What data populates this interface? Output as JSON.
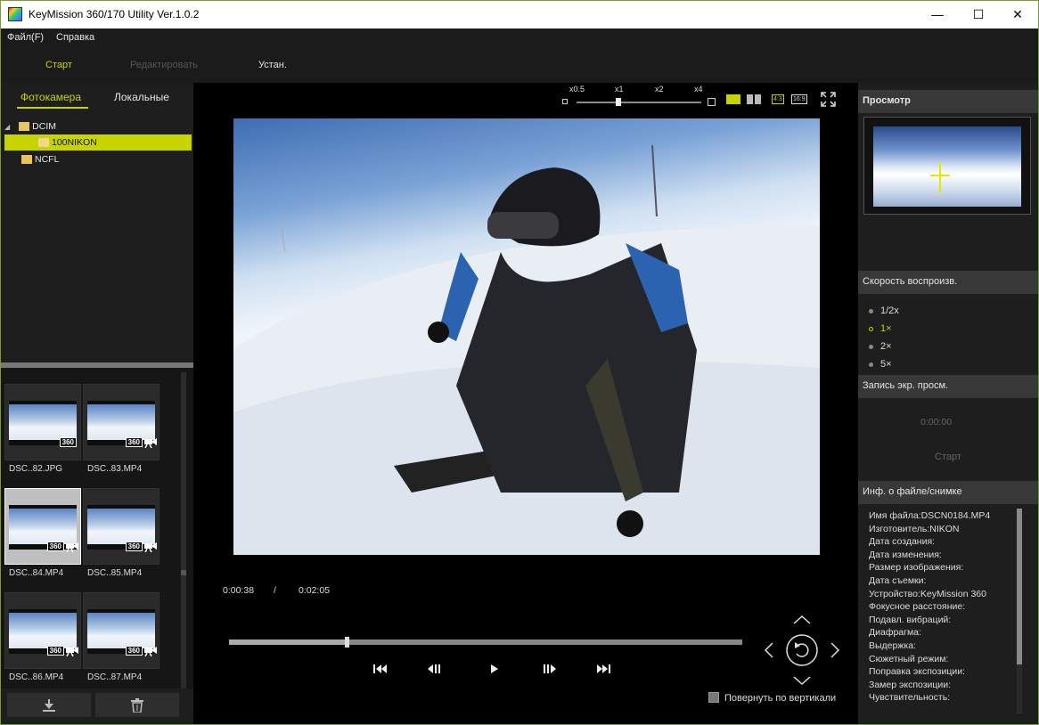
{
  "window": {
    "title": "KeyMission 360/170 Utility Ver.1.0.2",
    "minimize": "—",
    "maximize": "☐",
    "close": "✕"
  },
  "menu": [
    "Файл(F)",
    "Справка"
  ],
  "main_tabs": [
    {
      "label": "Старт",
      "state": "active"
    },
    {
      "label": "Редактировать",
      "state": "disabled"
    },
    {
      "label": "Устан.",
      "state": "normal"
    }
  ],
  "colors": {
    "accent": "#c8d400",
    "disabled": "#555555"
  },
  "source_tabs": [
    {
      "label": "Фотокамера",
      "active": true
    },
    {
      "label": "Локальные",
      "active": false
    }
  ],
  "tree": [
    {
      "label": "DCIM",
      "level": 0,
      "expanded": true
    },
    {
      "label": "100NIKON",
      "level": 1,
      "selected": true
    },
    {
      "label": "NCFL",
      "level": 0
    }
  ],
  "thumbnails": [
    {
      "label": "DSC..82.JPG",
      "badge": "360",
      "video": false,
      "selected": false
    },
    {
      "label": "DSC..83.MP4",
      "badge": "360",
      "video": true,
      "selected": false
    },
    {
      "label": "DSC..84.MP4",
      "badge": "360",
      "video": true,
      "selected": true
    },
    {
      "label": "DSC..85.MP4",
      "badge": "360",
      "video": true,
      "selected": false
    },
    {
      "label": "DSC..86.MP4",
      "badge": "360",
      "video": true,
      "selected": false
    },
    {
      "label": "DSC..87.MP4",
      "badge": "360",
      "video": true,
      "selected": false
    }
  ],
  "bottom_buttons": {
    "download_icon": "download-icon",
    "trash_icon": "trash-icon"
  },
  "speed_labels": [
    "x0.5",
    "x1",
    "x2",
    "x4"
  ],
  "aspect_buttons": [
    "4:3",
    "16:9"
  ],
  "playback": {
    "current": "0:00:38",
    "separator": "/",
    "total": "0:02:05",
    "progress": 0.23
  },
  "controls": [
    "skip-start-icon",
    "step-back-icon",
    "play-icon",
    "step-forward-icon",
    "skip-end-icon"
  ],
  "rotate_vertical": {
    "label": "Повернуть по вертикали",
    "checked": false
  },
  "right": {
    "preview_title": "Просмотр",
    "speed_title": "Скорость воспроизв.",
    "speed_options": [
      {
        "label": "1/2x",
        "selected": false
      },
      {
        "label": "1×",
        "selected": true
      },
      {
        "label": "2×",
        "selected": false
      },
      {
        "label": "5×",
        "selected": false
      }
    ],
    "record_title": "Запись экр. просм.",
    "record_time": "0:00:00",
    "record_start": "Старт",
    "info_title": "Инф. о файле/снимке",
    "info_lines": [
      "Имя файла:DSCN0184.MP4",
      "Изготовитель:NIKON",
      "Дата создания:",
      "Дата изменения:",
      "Размер изображения:",
      "Дата съемки:",
      "Устройство:KeyMission 360",
      "Фокусное расстояние:",
      "Подавл. вибраций:",
      "Диафрагма:",
      "Выдержка:",
      "Сюжетный режим:",
      "Поправка экспозиции:",
      "Замер экспозиции:",
      "Чувствительность:"
    ]
  }
}
